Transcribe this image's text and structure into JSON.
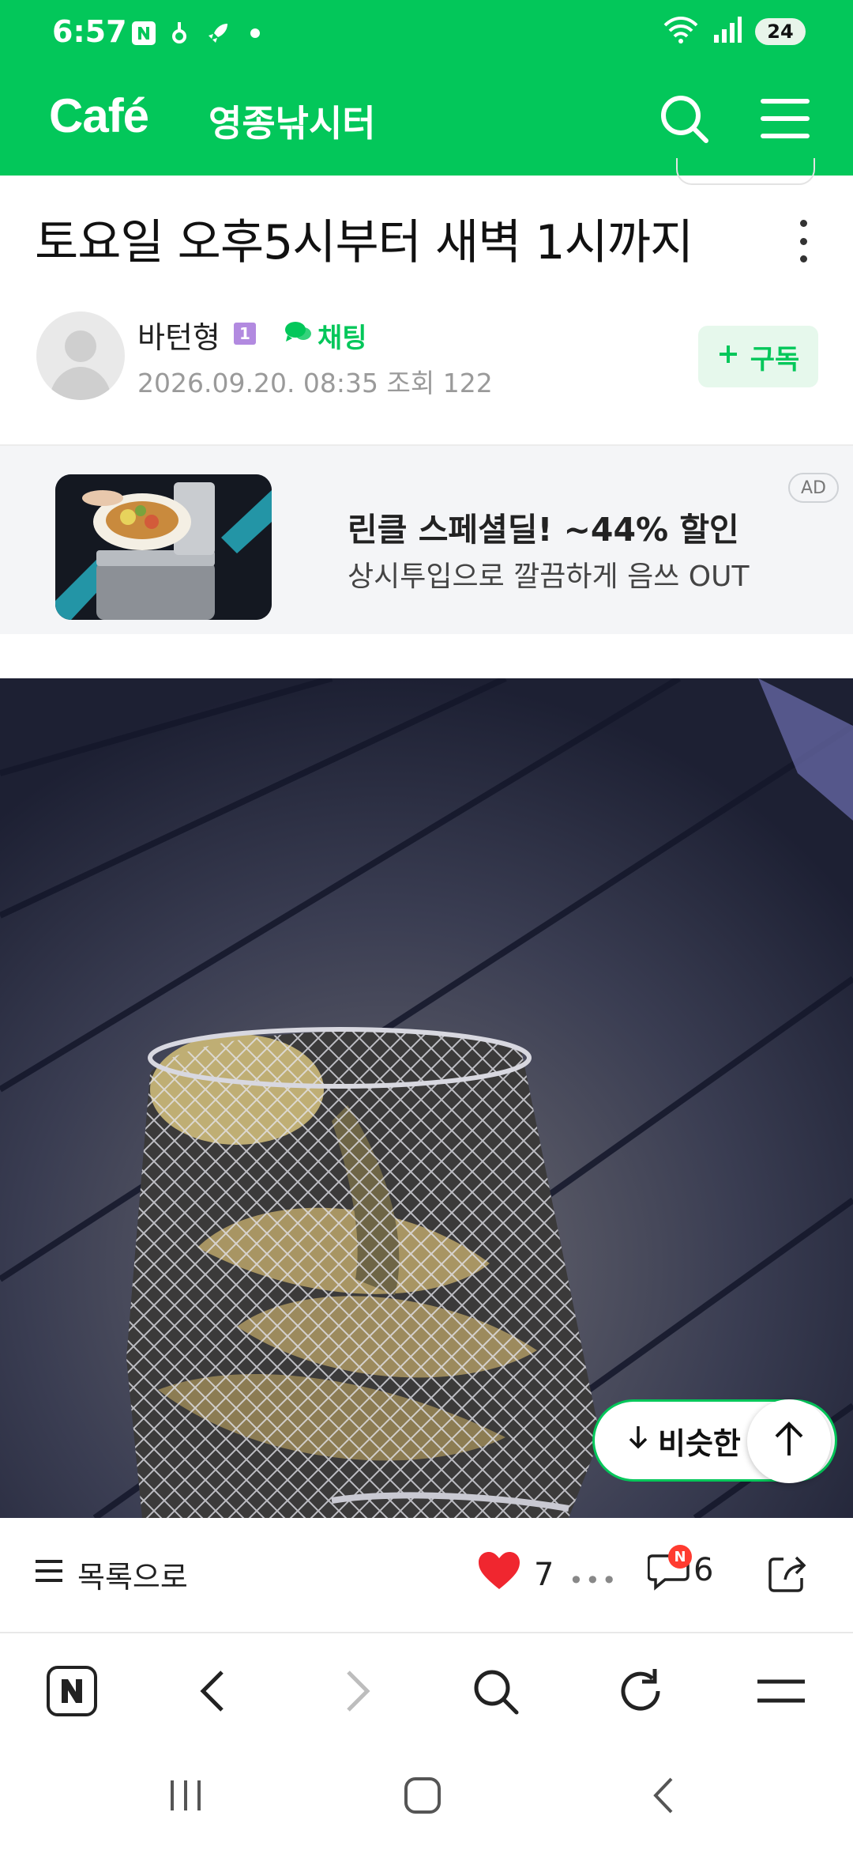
{
  "status_bar": {
    "time": "6:57",
    "battery": "24",
    "icons": [
      "naver-n-icon",
      "sync-icon",
      "rocket-icon",
      "dot-icon",
      "wifi-icon",
      "signal-icon",
      "battery-icon"
    ]
  },
  "app_bar": {
    "logo": "Café",
    "cafe_name": "영종낚시터",
    "icons": [
      "search-icon",
      "menu-icon"
    ]
  },
  "post": {
    "title": "토요일 오후5시부터 새벽 1시까지",
    "author": "바턴형",
    "grade": "1",
    "chat_label": "채팅",
    "date": "2026.09.20. 08:35",
    "views_label": "조회 122",
    "subscribe_label": "구독"
  },
  "ad": {
    "title": "린클 스페셜딜! ~44% 할인",
    "description": "상시투입으로 깔끔하게 음쓰 OUT",
    "badge": "AD"
  },
  "floating": {
    "similar_label": "비슷한"
  },
  "action_bar": {
    "list_label": "목록으로",
    "like_count": "7",
    "comment_count": "6",
    "comment_badge": "N"
  },
  "colors": {
    "brand_green": "#03C75A",
    "like_red": "#f0262f"
  }
}
